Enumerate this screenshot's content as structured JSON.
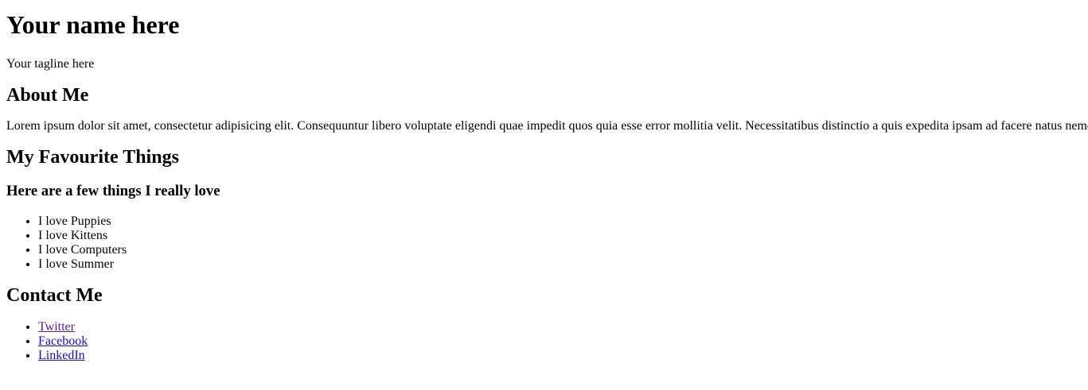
{
  "header": {
    "title": "Your name here",
    "tagline": "Your tagline here"
  },
  "about": {
    "heading": "About Me",
    "text": "Lorem ipsum dolor sit amet, consectetur adipisicing elit. Consequuntur libero voluptate eligendi quae impedit quos quia esse error mollitia velit. Necessitatibus distinctio a quis expedita ipsam ad facere natus nemo."
  },
  "favourites": {
    "heading": "My Favourite Things",
    "subheading": "Here are a few things I really love",
    "items": [
      "I love Puppies",
      "I love Kittens",
      "I love Computers",
      "I love Summer"
    ]
  },
  "contact": {
    "heading": "Contact Me",
    "links": [
      "Twitter",
      "Facebook",
      "LinkedIn"
    ]
  },
  "colors": {
    "link": "#1a0dab",
    "visited_link": "#551a8b",
    "text": "#000000",
    "background": "#ffffff"
  }
}
